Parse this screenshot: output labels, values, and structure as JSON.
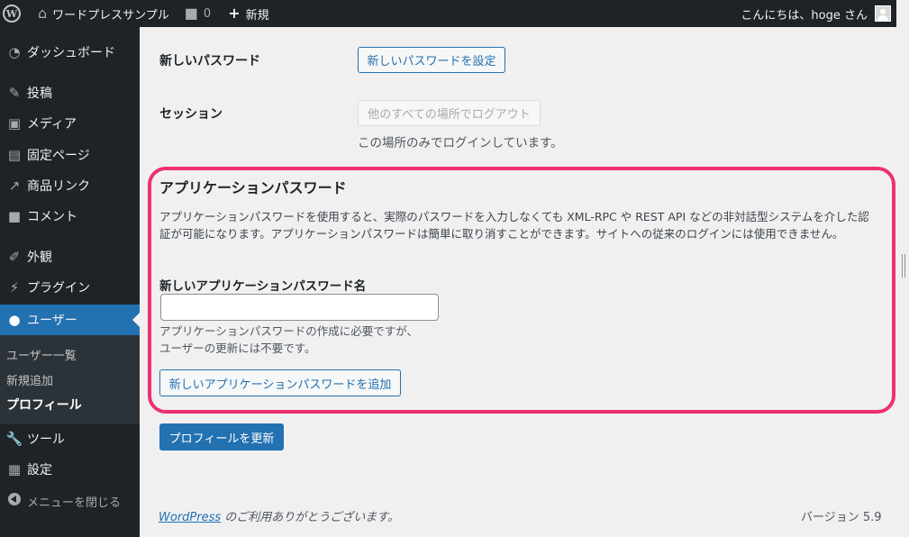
{
  "adminbar": {
    "site_name": "ワードプレスサンプル",
    "comments_count": "0",
    "new_label": "新規",
    "greeting": "こんにちは、hoge さん"
  },
  "sidebar": {
    "items": [
      {
        "label": "ダッシュボード",
        "icon": "dashboard-icon"
      },
      {
        "label": "投稿",
        "icon": "pin-icon"
      },
      {
        "label": "メディア",
        "icon": "media-icon"
      },
      {
        "label": "固定ページ",
        "icon": "page-icon"
      },
      {
        "label": "商品リンク",
        "icon": "link-icon"
      },
      {
        "label": "コメント",
        "icon": "comment-icon"
      },
      {
        "label": "外観",
        "icon": "brush-icon"
      },
      {
        "label": "プラグイン",
        "icon": "plugin-icon"
      },
      {
        "label": "ユーザー",
        "icon": "user-icon"
      },
      {
        "label": "ツール",
        "icon": "wrench-icon"
      },
      {
        "label": "設定",
        "icon": "settings-icon"
      }
    ],
    "submenu": [
      "ユーザー一覧",
      "新規追加",
      "プロフィール"
    ],
    "collapse_label": "メニューを閉じる"
  },
  "content": {
    "new_password_label": "新しいパスワード",
    "new_password_button": "新しいパスワードを設定",
    "session_label": "セッション",
    "logout_everywhere_button": "他のすべての場所でログアウト",
    "session_desc": "この場所のみでログインしています。",
    "app_passwords": {
      "title": "アプリケーションパスワード",
      "desc": "アプリケーションパスワードを使用すると、実際のパスワードを入力しなくても XML-RPC や REST API などの非対話型システムを介した認証が可能になります。アプリケーションパスワードは簡単に取り消すことができます。サイトへの従来のログインには使用できません。",
      "name_label": "新しいアプリケーションパスワード名",
      "name_value": "",
      "hint_line1": "アプリケーションパスワードの作成に必要ですが、",
      "hint_line2": "ユーザーの更新には不要です。",
      "add_button": "新しいアプリケーションパスワードを追加"
    },
    "update_button": "プロフィールを更新"
  },
  "footer": {
    "link_text": "WordPress",
    "thanks_text": " のご利用ありがとうございます。",
    "version": "バージョン 5.9"
  },
  "colors": {
    "accent": "#2271b1",
    "highlight": "#ef2f74",
    "sidebar_bg": "#1d2327"
  }
}
